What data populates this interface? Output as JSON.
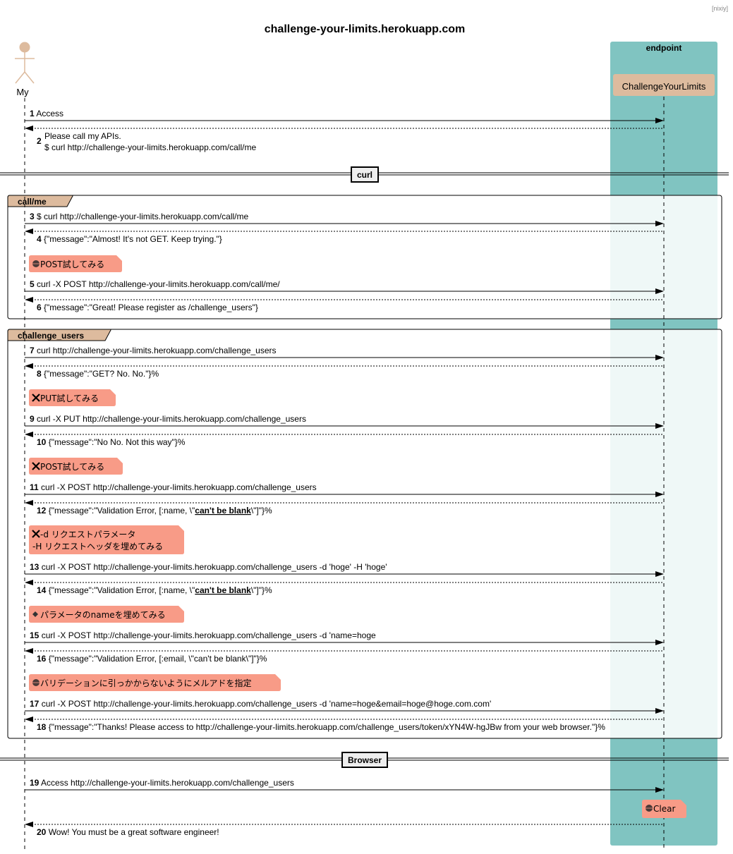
{
  "header_tag": "[nixiy]",
  "title": "challenge-your-limits.herokuapp.com",
  "colors": {
    "box_fill": "#80C4C1",
    "participant_fill": "#DDBB9E",
    "note_fill": "#F89B87",
    "group_tab_fill": "#DDBB9E",
    "group_body_fill": "#EFF8F7",
    "divider_fill": "#EEEEEE"
  },
  "actor": {
    "name": "My"
  },
  "box": {
    "label": "endpoint"
  },
  "participant": {
    "name": "ChallengeYourLimits"
  },
  "dividers": [
    {
      "label": "curl"
    },
    {
      "label": "Browser"
    }
  ],
  "groups": [
    {
      "label": "call/me"
    },
    {
      "label": "challenge_users"
    }
  ],
  "messages": [
    {
      "num": "1",
      "dir": "right",
      "lines": [
        "Access"
      ]
    },
    {
      "num": "2",
      "dir": "left",
      "lines": [
        "Please call my APIs.",
        "$ curl http://challenge-your-limits.herokuapp.com/call/me"
      ]
    },
    {
      "num": "3",
      "dir": "right",
      "lines": [
        "$ curl http://challenge-your-limits.herokuapp.com/call/me"
      ]
    },
    {
      "num": "4",
      "dir": "left",
      "lines": [
        "{\"message\":\"Almost! It's not GET. Keep trying.\"}"
      ]
    },
    {
      "num": "5",
      "dir": "right",
      "lines": [
        "curl -X POST http://challenge-your-limits.herokuapp.com/call/me/"
      ]
    },
    {
      "num": "6",
      "dir": "left",
      "lines": [
        "{\"message\":\"Great! Please register as /challenge_users\"}"
      ]
    },
    {
      "num": "7",
      "dir": "right",
      "lines": [
        "curl http://challenge-your-limits.herokuapp.com/challenge_users"
      ]
    },
    {
      "num": "8",
      "dir": "left",
      "lines": [
        "{\"message\":\"GET? No. No.\"}%"
      ]
    },
    {
      "num": "9",
      "dir": "right",
      "lines": [
        "curl -X PUT http://challenge-your-limits.herokuapp.com/challenge_users"
      ]
    },
    {
      "num": "10",
      "dir": "left",
      "lines": [
        "{\"message\":\"No No. Not this way\"}%"
      ]
    },
    {
      "num": "11",
      "dir": "right",
      "lines": [
        "curl -X POST http://challenge-your-limits.herokuapp.com/challenge_users"
      ]
    },
    {
      "num": "12",
      "dir": "left",
      "parts": [
        "{\"message\":\"Validation Error, [:name, \\\"",
        "can't be blank",
        "\\\"]\"}%"
      ]
    },
    {
      "num": "13",
      "dir": "right",
      "lines": [
        "curl -X POST http://challenge-your-limits.herokuapp.com/challenge_users -d 'hoge' -H 'hoge'"
      ]
    },
    {
      "num": "14",
      "dir": "left",
      "parts": [
        "{\"message\":\"Validation Error, [:name, \\\"",
        "can't be blank",
        "\\\"]\"}%"
      ]
    },
    {
      "num": "15",
      "dir": "right",
      "lines": [
        "curl -X POST http://challenge-your-limits.herokuapp.com/challenge_users -d 'name=hoge"
      ]
    },
    {
      "num": "16",
      "dir": "left",
      "lines": [
        "{\"message\":\"Validation Error, [:email, \\\"can't be blank\\\"]\"}%"
      ]
    },
    {
      "num": "17",
      "dir": "right",
      "lines": [
        "curl -X POST http://challenge-your-limits.herokuapp.com/challenge_users -d 'name=hoge&email=hoge@hoge.com.com'"
      ]
    },
    {
      "num": "18",
      "dir": "left",
      "lines": [
        "{\"message\":\"Thanks! Please access to http://challenge-your-limits.herokuapp.com/challenge_users/token/xYN4W-hgJBw  from your web browser.\"}%"
      ]
    },
    {
      "num": "19",
      "dir": "right",
      "lines": [
        "Access http://challenge-your-limits.herokuapp.com/challenge_users"
      ]
    },
    {
      "num": "20",
      "dir": "left",
      "lines": [
        "Wow! You must be a great software engineer!"
      ]
    }
  ],
  "notes": [
    {
      "icon": "circle-icon",
      "lines": [
        "POST試してみる"
      ]
    },
    {
      "icon": "cross-icon",
      "lines": [
        "PUT試してみる"
      ]
    },
    {
      "icon": "cross-icon",
      "lines": [
        "POST試してみる"
      ]
    },
    {
      "icon": "cross-icon",
      "lines": [
        "-d リクエストパラメータ",
        "-H リクエストヘッダを埋めてみる"
      ]
    },
    {
      "icon": "diamond-icon",
      "lines": [
        "パラメータのnameを埋めてみる"
      ]
    },
    {
      "icon": "circle-icon",
      "lines": [
        "バリデーションに引っかからないようにメルアドを指定"
      ]
    },
    {
      "icon": "circle-icon",
      "lines": [
        "Clear"
      ]
    }
  ]
}
